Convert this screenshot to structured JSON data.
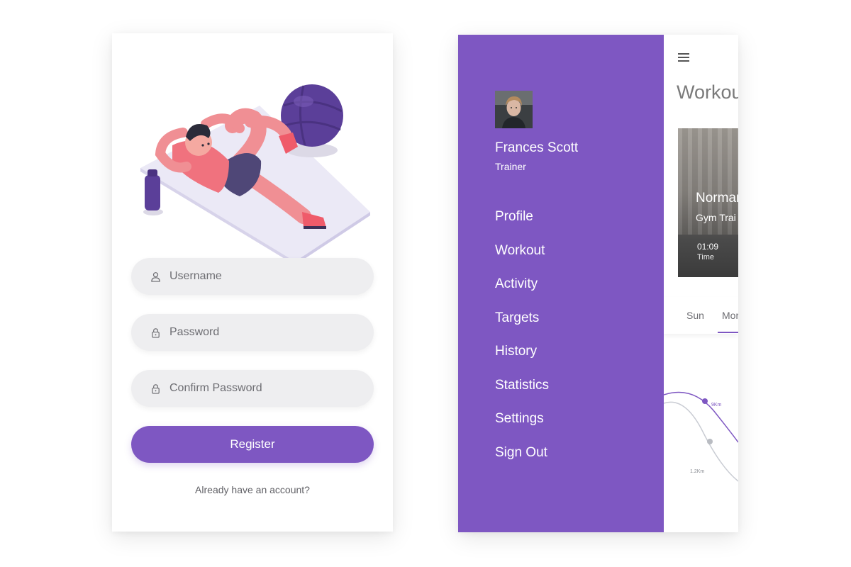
{
  "register": {
    "username_placeholder": "Username",
    "password_placeholder": "Password",
    "confirm_placeholder": "Confirm Password",
    "register_label": "Register",
    "login_prompt": "Already have an account?"
  },
  "drawer": {
    "user_name": "Frances Scott",
    "user_role": "Trainer",
    "menu": [
      {
        "label": "Profile"
      },
      {
        "label": "Workout"
      },
      {
        "label": "Activity"
      },
      {
        "label": "Targets"
      },
      {
        "label": "History"
      },
      {
        "label": "Statistics"
      },
      {
        "label": "Settings"
      },
      {
        "label": "Sign Out"
      }
    ]
  },
  "workout": {
    "title": "Workou",
    "card_name": "Normar",
    "card_role": "Gym Trai",
    "card_time": "01:09",
    "card_time_label": "Time",
    "tabs": [
      "Sun",
      "Mor"
    ],
    "chart_label_1": "9Km",
    "chart_label_2": "1.2Km"
  },
  "colors": {
    "accent": "#7e57c2",
    "field_bg": "#eeeef0",
    "text_muted": "#6d6d72"
  }
}
